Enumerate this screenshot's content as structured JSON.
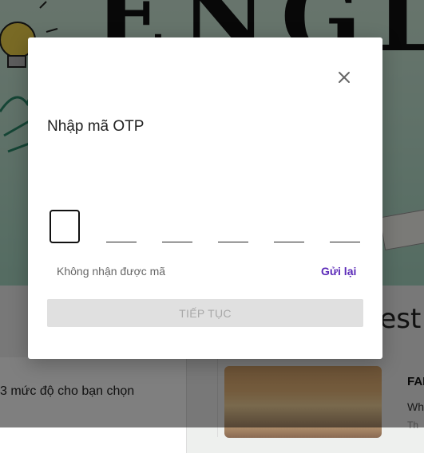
{
  "background": {
    "hero_text": "ENGLI",
    "section_word": "test",
    "left_card_text": "3 mức độ cho bạn chọn",
    "right_card_title": "FAI",
    "right_card_sub": "Wh",
    "right_card_sub2": "Th"
  },
  "modal": {
    "close_icon": "close-icon",
    "title": "Nhập mã OTP",
    "otp_length": 6,
    "hint": "Không nhận được mã",
    "resend_label": "Gửi lại",
    "continue_label": "TIẾP TỤC"
  },
  "colors": {
    "accent": "#5b2ab8",
    "button_disabled_bg": "#e0e0e0",
    "button_disabled_text": "#a8a8a8"
  }
}
